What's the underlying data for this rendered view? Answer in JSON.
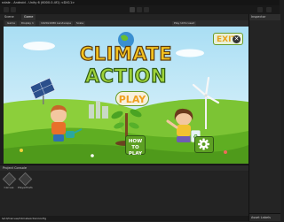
{
  "titlebar": {
    "text": "ndale - Android - Unity 6 (6000.0.4f1) <DX11>"
  },
  "tabs": {
    "scene": "Scene",
    "game": "Game"
  },
  "gamebar": {
    "game_label": "Game",
    "display": "Display 1",
    "resolution": "1920x1080 Landscape",
    "scale": "Scale",
    "play_mode": "Play Unfocused"
  },
  "inspector": {
    "title": "Inspector",
    "labels": "Asset Labels"
  },
  "bottom": {
    "tabs": "Project  Console",
    "asset1": "Canvas",
    "asset2": "PlayerPrefs"
  },
  "status": {
    "text": "ls/UI/Canvas/ClimateActionConfig"
  },
  "game": {
    "title_line1": "CLIMATE",
    "title_line2": "ACTION",
    "play": "PLAY",
    "exit": "EXIT",
    "howto_line1": "HOW",
    "howto_line2": "TO",
    "howto_line3": "PLAY"
  },
  "colors": {
    "sky": "#bfe7f6",
    "grass": "#6fbf2a",
    "title_yellow": "#f4c21f",
    "title_green": "#9ed23a"
  }
}
